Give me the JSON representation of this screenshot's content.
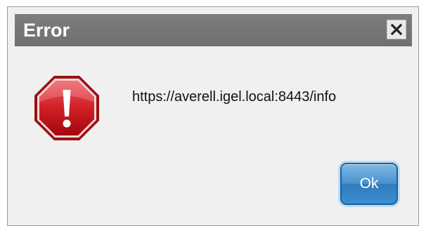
{
  "dialog": {
    "title": "Error",
    "message": "https://averell.igel.local:8443/info",
    "ok_label": "Ok",
    "icons": {
      "close": "close-icon",
      "status": "error-stop-icon"
    },
    "colors": {
      "titlebar": "#737373",
      "error_red": "#c8161d",
      "button_blue": "#3d8fd0"
    }
  }
}
